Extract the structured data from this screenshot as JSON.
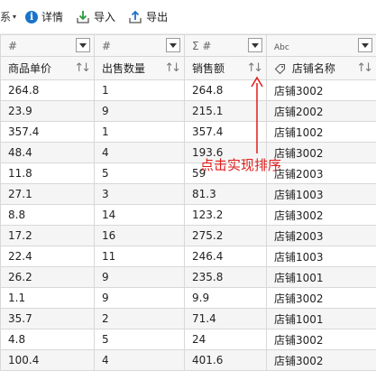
{
  "toolbar": {
    "cut_text": "系",
    "details_label": "详情",
    "import_label": "导入",
    "export_label": "导出"
  },
  "columns": [
    {
      "type_label": "#",
      "name": "商品单价"
    },
    {
      "type_label": "#",
      "name": "出售数量"
    },
    {
      "type_label": "Σ #",
      "name": "销售额"
    },
    {
      "type_label": "Abc",
      "name": "店铺名称"
    }
  ],
  "rows": [
    [
      "264.8",
      "1",
      "264.8",
      "店铺3002"
    ],
    [
      "23.9",
      "9",
      "215.1",
      "店铺2002"
    ],
    [
      "357.4",
      "1",
      "357.4",
      "店铺1002"
    ],
    [
      "48.4",
      "4",
      "193.6",
      "店铺3002"
    ],
    [
      "11.8",
      "5",
      "59",
      "店铺2003"
    ],
    [
      "27.1",
      "3",
      "81.3",
      "店铺1003"
    ],
    [
      "8.8",
      "14",
      "123.2",
      "店铺3002"
    ],
    [
      "17.2",
      "16",
      "275.2",
      "店铺2003"
    ],
    [
      "22.4",
      "11",
      "246.4",
      "店铺1003"
    ],
    [
      "26.2",
      "9",
      "235.8",
      "店铺1001"
    ],
    [
      "1.1",
      "9",
      "9.9",
      "店铺3002"
    ],
    [
      "35.7",
      "2",
      "71.4",
      "店铺1001"
    ],
    [
      "4.8",
      "5",
      "24",
      "店铺3002"
    ],
    [
      "100.4",
      "4",
      "401.6",
      "店铺3002"
    ]
  ],
  "annotation": {
    "text": "点击实现排序",
    "color": "#e01b1b"
  },
  "colors": {
    "accent": "#1a73c9",
    "annotation": "#e01b1b"
  }
}
